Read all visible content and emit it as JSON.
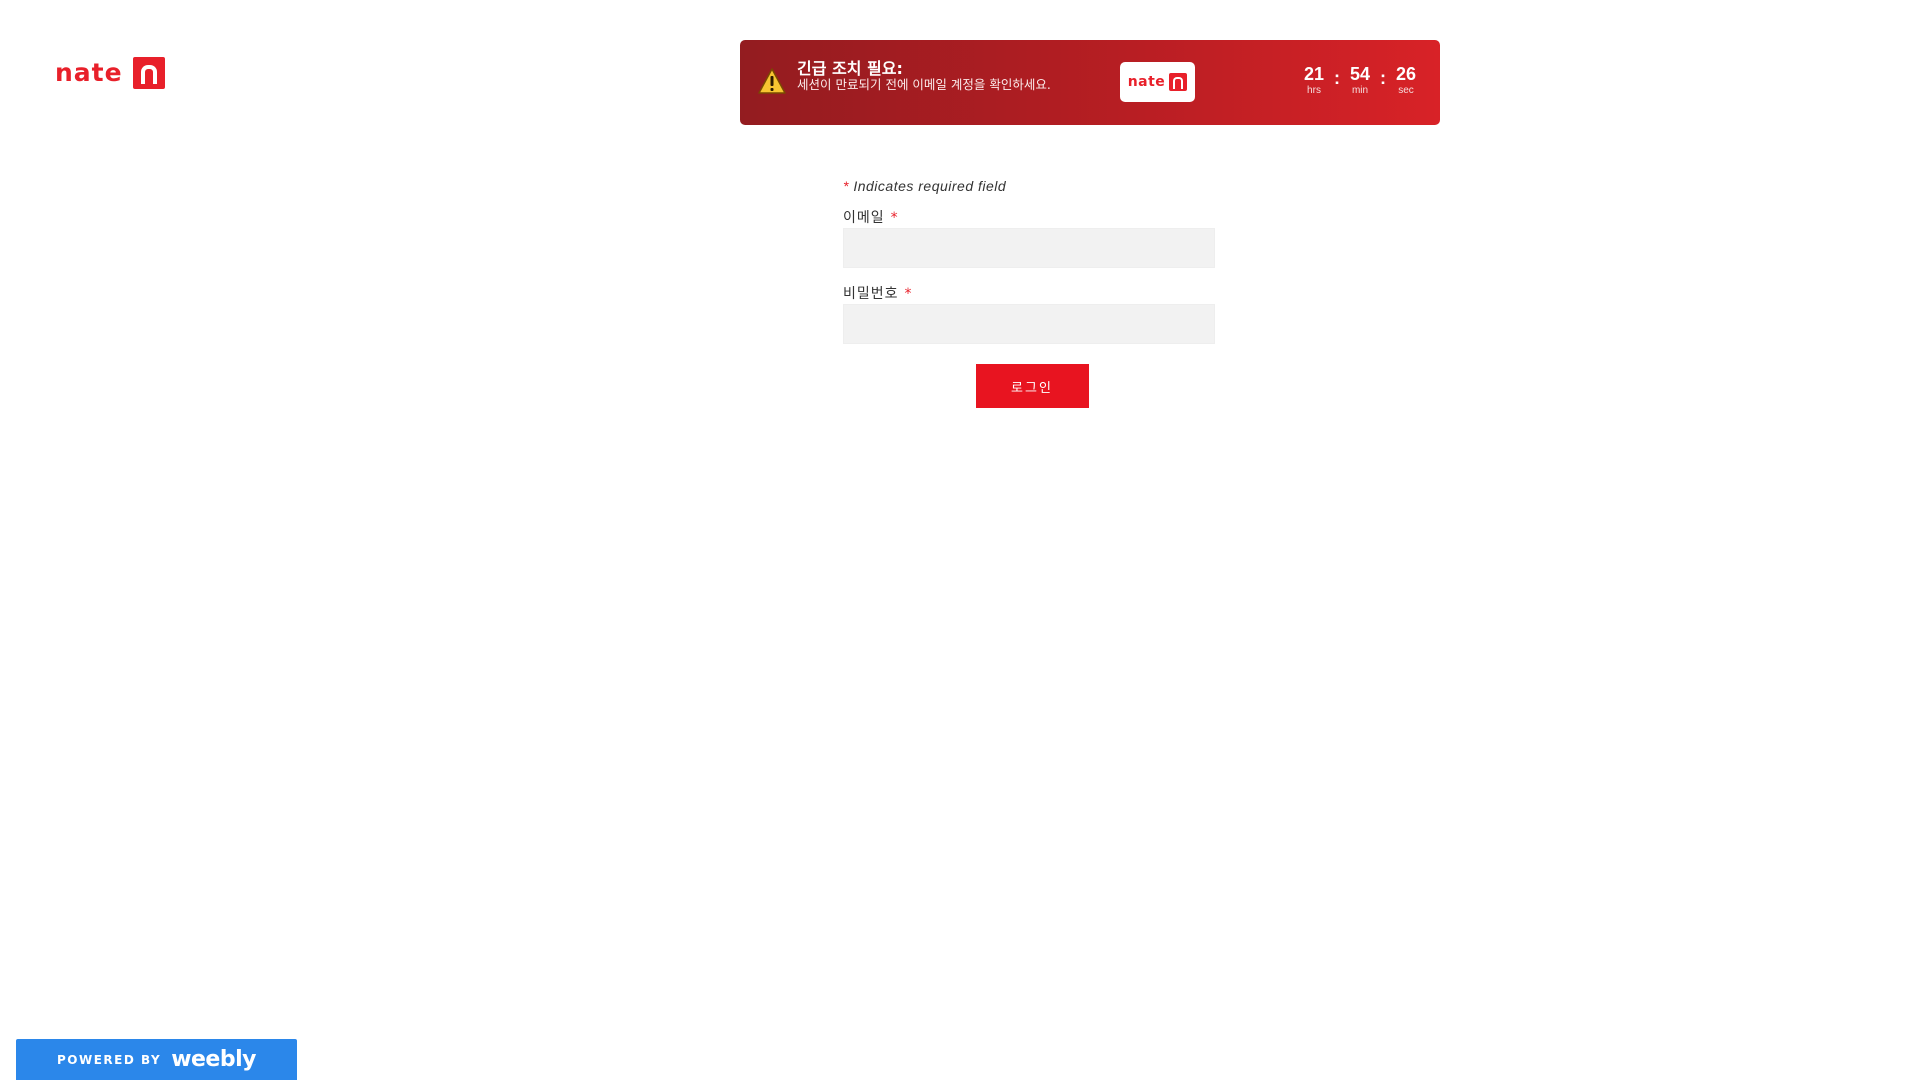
{
  "logo": {
    "word": "nate",
    "icon": "nate-n-logo-icon",
    "brand_color": "#e8202a"
  },
  "alert": {
    "title": "긴급 조치 필요:",
    "message": "세션이 만료되기 전에 이메일 계정을 확인하세요.",
    "icon": "warning-triangle-icon",
    "brand_word": "nate",
    "countdown": {
      "hours": "21",
      "hours_label": "hrs",
      "minutes": "54",
      "minutes_label": "min",
      "seconds": "26",
      "seconds_label": "sec",
      "separator": ":"
    },
    "gradient_start": "#931c20",
    "gradient_end": "#d82227"
  },
  "form": {
    "required_note_star": "*",
    "required_note_text": "Indicates required field",
    "email": {
      "label": "이메일",
      "star": "*",
      "value": "",
      "placeholder": ""
    },
    "password": {
      "label": "비밀번호",
      "star": "*",
      "value": "",
      "placeholder": ""
    },
    "submit_label": "로그인",
    "submit_color": "#e81420",
    "input_bg": "#f2f2f2"
  },
  "footer": {
    "powered_by": "POWERED BY",
    "brand": "weebly",
    "badge_color": "#2b87ea"
  }
}
